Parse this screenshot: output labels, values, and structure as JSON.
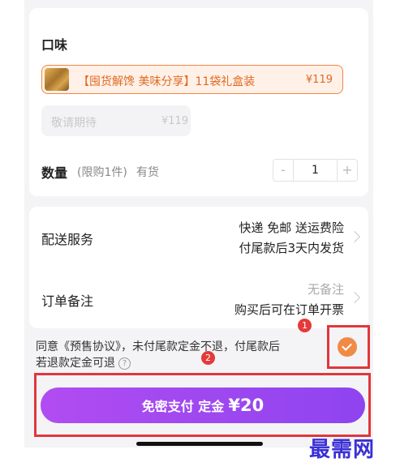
{
  "flavor": {
    "title": "口味",
    "selected_option": {
      "name": "【囤货解馋 美味分享】11袋礼盒装",
      "price": "¥119"
    },
    "pending_option": {
      "name": "敬请期待",
      "price": "¥119"
    }
  },
  "quantity": {
    "label": "数量",
    "limit_note": "(限购1件)",
    "stock": "有货",
    "minus": "-",
    "value": "1",
    "plus": "+"
  },
  "shipping": {
    "label": "配送服务",
    "line1": "快递 免邮 送运费险",
    "line2": "付尾款后3天内发货"
  },
  "remark": {
    "label": "订单备注",
    "value": "无备注",
    "invoice": "购买后可在订单开票"
  },
  "agreement": {
    "line1": "同意《预售协议》，未付尾款定金不退，付尾款后",
    "line2": "若退款定金可退",
    "help": "?"
  },
  "badges": {
    "one": "1",
    "two": "2"
  },
  "pay": {
    "label": "免密支付 定金",
    "amount": "¥20"
  },
  "watermark": "最需网",
  "colors": {
    "accent_orange": "#f08a45",
    "pay_purple": "#9b47f0",
    "annotation_red": "#e0373c"
  }
}
